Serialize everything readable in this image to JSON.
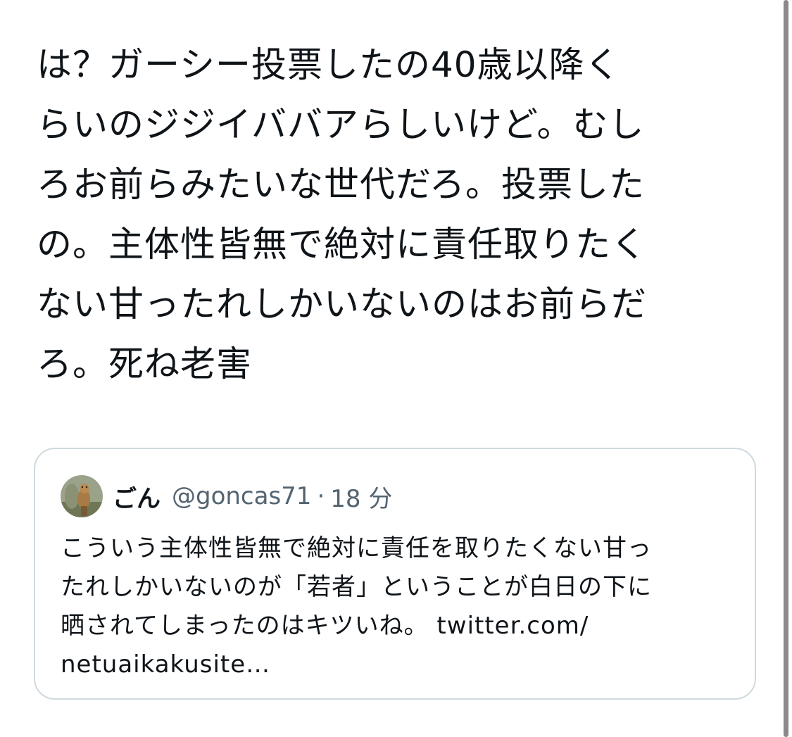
{
  "tweet": {
    "text": "は？ガーシー投票したの40歳以降く\nらいのジジイババアらしいけど。むし\nろお前らみたいな世代だろ。投票した\nの。主体性皆無で絶対に責任取りたく\nない甘ったれしかいないのはお前らだ\nろ。死ね老害"
  },
  "quoted_tweet": {
    "avatar_icon": "user-avatar-icon",
    "author_name": "ごん",
    "author_handle": "@goncas71",
    "separator": "·",
    "timestamp": "18 分",
    "text": "こういう主体性皆無で絶対に責任を取りたくない甘っ\nたれしかいないのが「若者」ということが白日の下に\n晒されてしまったのはキツいね。 twitter.com/\nnetuaikakusite…"
  },
  "colors": {
    "text_primary": "#0f1419",
    "text_secondary": "#536471",
    "card_border": "#cfd9de",
    "scrollbar": "#8a8a8a"
  }
}
